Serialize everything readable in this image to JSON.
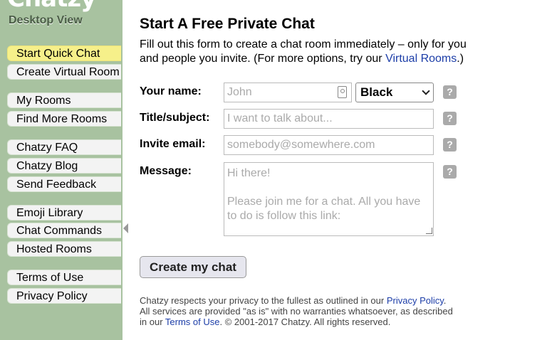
{
  "sidebar": {
    "logo": "Chatzy",
    "desktop_view": "Desktop View",
    "nav": [
      {
        "label": "Start Quick Chat",
        "active": true
      },
      {
        "label": "Create Virtual Room"
      },
      {
        "label": "My Rooms"
      },
      {
        "label": "Find More Rooms"
      },
      {
        "label": "Chatzy FAQ"
      },
      {
        "label": "Chatzy Blog"
      },
      {
        "label": "Send Feedback"
      },
      {
        "label": "Emoji Library"
      },
      {
        "label": "Chat Commands"
      },
      {
        "label": "Hosted Rooms"
      },
      {
        "label": "Terms of Use"
      },
      {
        "label": "Privacy Policy"
      }
    ]
  },
  "main": {
    "title": "Start A Free Private Chat",
    "intro_text": "Fill out this form to create a chat room immediately – only for you and people you invite. (For more options, try our ",
    "intro_link": "Virtual Rooms",
    "intro_end": ".)"
  },
  "form": {
    "name_label": "Your name:",
    "name_placeholder": "John",
    "color_selected": "Black",
    "subject_label": "Title/subject:",
    "subject_placeholder": "I want to talk about...",
    "email_label": "Invite email:",
    "email_placeholder": "somebody@somewhere.com",
    "message_label": "Message:",
    "message_placeholder": "Hi there!\n\nPlease join me for a chat. All you have to do is follow this link:",
    "help_symbol": "?",
    "submit_label": "Create my chat"
  },
  "footer": {
    "line1_text": "Chatzy respects your privacy to the fullest as outlined in our ",
    "privacy_link": "Privacy Policy",
    "line1_end": ".",
    "line2_text": " All services are provided \"as is\" with no warranties whatsoever, as described in our ",
    "terms_link": "Terms of Use",
    "line2_end": ". © 2001-2017 Chatzy. All rights reserved."
  },
  "colors": {
    "sidebar_bg": "#a8c2a0",
    "active_item": "#f6f08a",
    "link": "#1d3ea8"
  }
}
